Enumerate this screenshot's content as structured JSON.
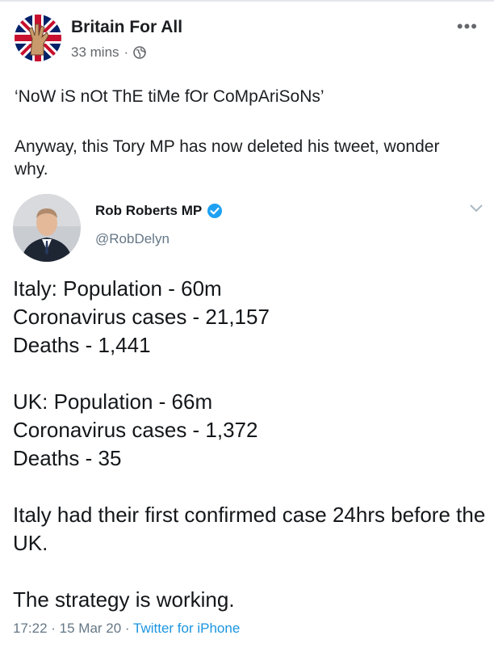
{
  "post": {
    "page_name": "Britain For All",
    "time": "33 mins",
    "separator": "·",
    "more_label": "•••",
    "text_line1": "‘NoW iS nOt ThE tiMe fOr CoMpAriSoNs’",
    "text_line2": "Anyway, this Tory MP has now deleted his tweet, wonder why."
  },
  "tweet": {
    "name": "Rob Roberts MP",
    "handle": "@RobDelyn",
    "block1": [
      "Italy: Population - 60m",
      "Coronavirus cases - 21,157",
      "Deaths - 1,441"
    ],
    "block2": [
      "UK: Population - 66m",
      "Coronavirus cases - 1,372",
      "Deaths - 35"
    ],
    "block3": "Italy had their first confirmed case 24hrs before the UK.",
    "block4": "The strategy is working.",
    "timestamp": "17:22 · 15 Mar 20 · ",
    "source": "Twitter for iPhone"
  },
  "colors": {
    "link": "#1b95e0",
    "verified": "#1da1f2",
    "muted": "#65676b"
  },
  "icons": [
    "globe-icon",
    "verified-badge-icon",
    "chevron-down-icon",
    "more-options-icon"
  ]
}
